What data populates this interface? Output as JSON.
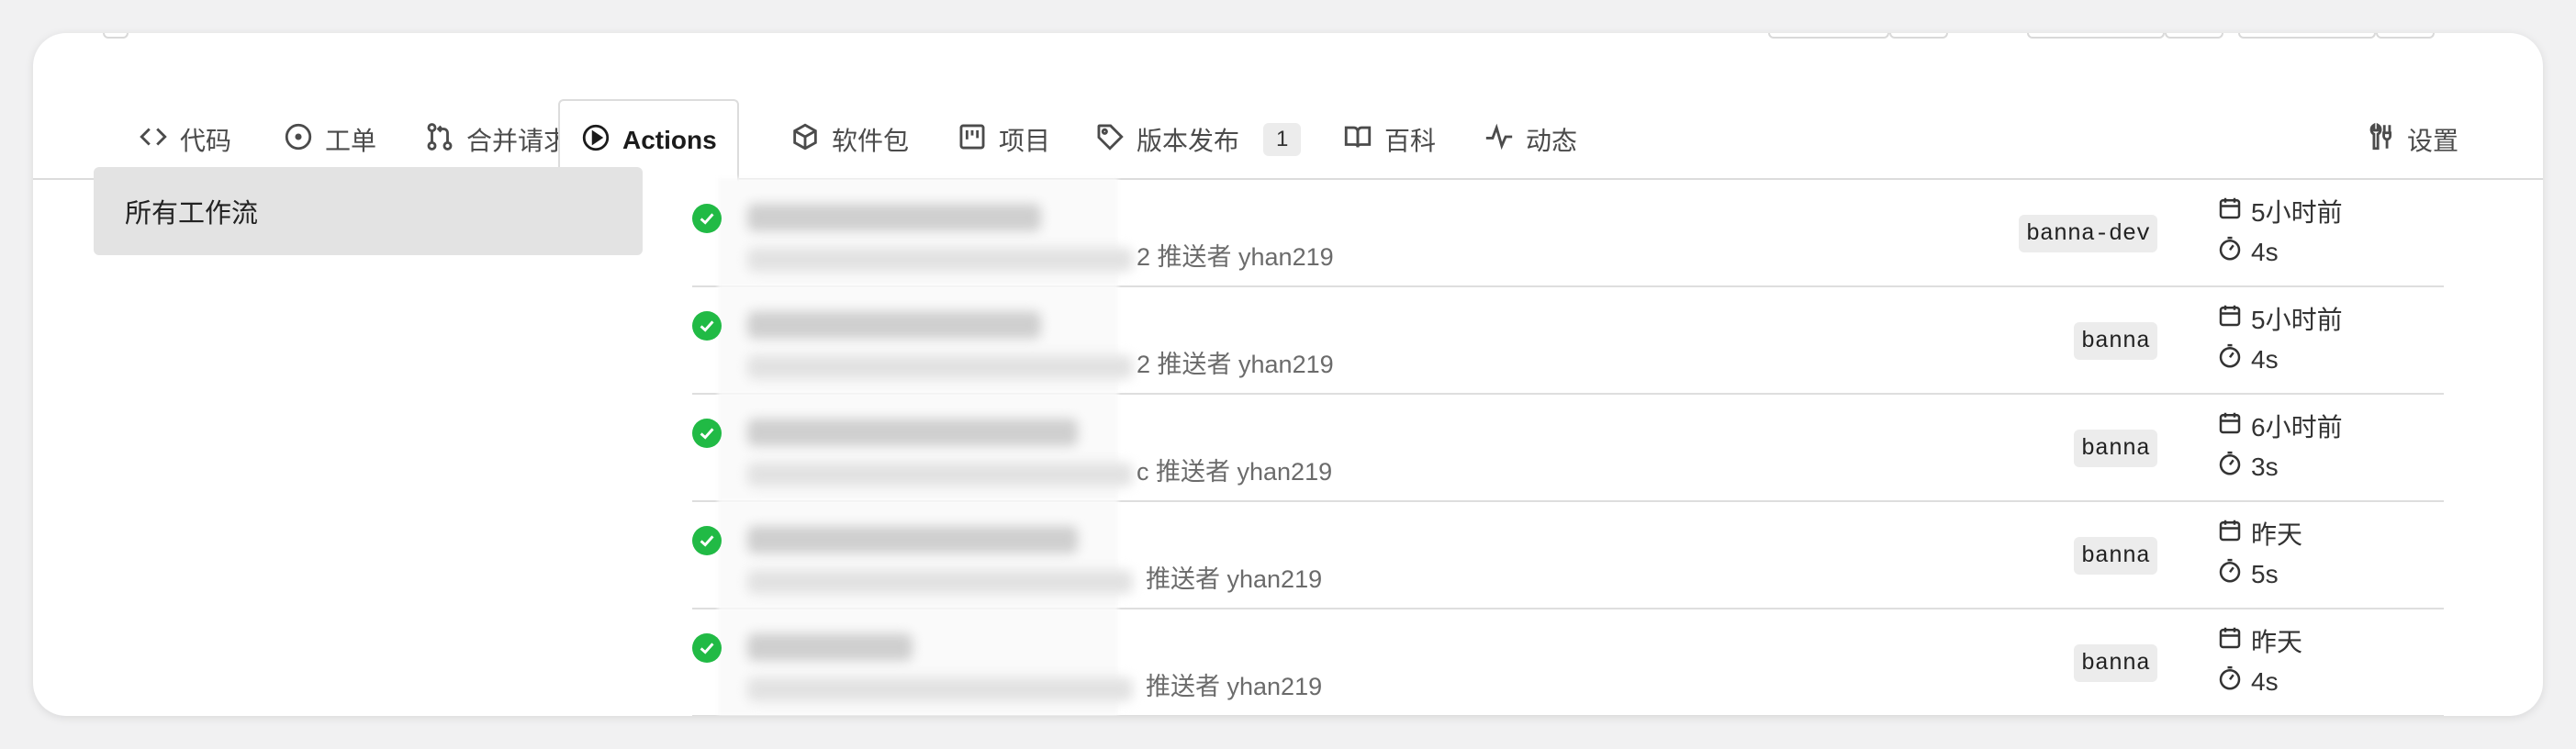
{
  "tabs": [
    {
      "label": "代码",
      "icon": "code-icon"
    },
    {
      "label": "工单",
      "icon": "issue-icon"
    },
    {
      "label": "合并请求",
      "icon": "pull-request-icon"
    },
    {
      "label": "Actions",
      "icon": "play-icon",
      "active": true
    },
    {
      "label": "软件包",
      "icon": "package-icon"
    },
    {
      "label": "项目",
      "icon": "project-icon"
    },
    {
      "label": "版本发布",
      "icon": "tag-icon",
      "count": "1"
    },
    {
      "label": "百科",
      "icon": "book-icon"
    },
    {
      "label": "动态",
      "icon": "pulse-icon"
    },
    {
      "label": "设置",
      "icon": "tools-icon"
    }
  ],
  "sidebar": {
    "items": [
      {
        "label": "所有工作流",
        "active": true
      }
    ]
  },
  "runs": [
    {
      "status": "success",
      "subtext": "2 推送者 yhan219",
      "branch": "banna-dev",
      "time": "5小时前",
      "duration": "4s"
    },
    {
      "status": "success",
      "subtext": "2 推送者 yhan219",
      "branch": "banna",
      "time": "5小时前",
      "duration": "4s"
    },
    {
      "status": "success",
      "subtext": "c 推送者 yhan219",
      "branch": "banna",
      "time": "6小时前",
      "duration": "3s"
    },
    {
      "status": "success",
      "subtext": "推送者 yhan219",
      "branch": "banna",
      "time": "昨天",
      "duration": "5s"
    },
    {
      "status": "success",
      "subtext": "推送者 yhan219",
      "branch": "banna",
      "time": "昨天",
      "duration": "4s"
    }
  ],
  "colors": {
    "success": "#21ba45",
    "background": "#f1f1f2",
    "active_sidebar": "#e3e3e3"
  }
}
